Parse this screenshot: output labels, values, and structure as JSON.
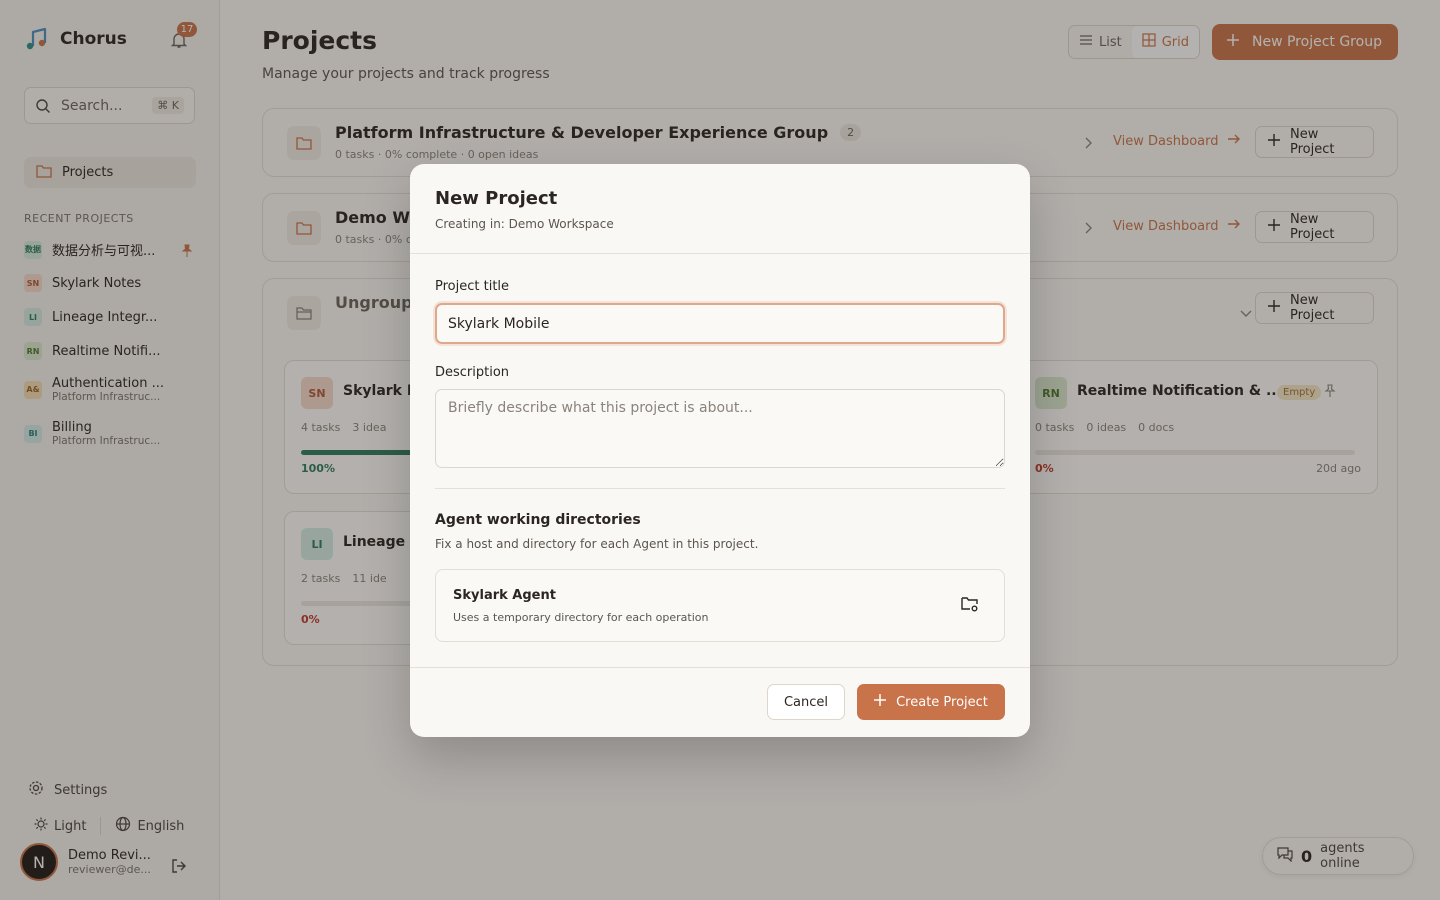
{
  "app": {
    "name": "Chorus",
    "notifications": "17"
  },
  "sidebar": {
    "search_placeholder": "Search...",
    "search_shortcut": "⌘ K",
    "nav_projects": "Projects",
    "recent_title": "RECENT PROJECTS",
    "recent": [
      {
        "abbr": "数据",
        "title": "数据分析与可视...",
        "sub": "",
        "pinned": true
      },
      {
        "abbr": "SN",
        "title": "Skylark Notes",
        "sub": ""
      },
      {
        "abbr": "LI",
        "title": "Lineage Integr...",
        "sub": ""
      },
      {
        "abbr": "RN",
        "title": "Realtime Notifi...",
        "sub": ""
      },
      {
        "abbr": "A&",
        "title": "Authentication ...",
        "sub": "Platform Infrastruc..."
      },
      {
        "abbr": "BI",
        "title": "Billing",
        "sub": "Platform Infrastruc..."
      }
    ],
    "settings": "Settings",
    "theme": "Light",
    "language": "English",
    "user": {
      "initial": "N",
      "name": "Demo Revi...",
      "email": "reviewer@de..."
    }
  },
  "main": {
    "title": "Projects",
    "subtitle": "Manage your projects and track progress",
    "view_list": "List",
    "view_grid": "Grid",
    "new_group": "New Project Group",
    "groups": [
      {
        "title": "Platform Infrastructure & Developer Experience Group",
        "count": "2",
        "meta": "0 tasks · 0% complete · 0 open ideas",
        "dashboard": "View Dashboard",
        "new_project": "New Project"
      },
      {
        "title": "Demo W",
        "meta": "0 tasks · 0% c",
        "dashboard": "View Dashboard",
        "new_project": "New Project"
      },
      {
        "title": "Ungroup",
        "new_project": "New Project"
      }
    ],
    "cards": [
      {
        "abbr": "SN",
        "title": "Skylark N",
        "tasks": "4 tasks",
        "ideas": "3 idea",
        "pct": "100%",
        "progress": 1.0
      },
      {
        "abbr": "RN",
        "title": "Realtime Notification & ...",
        "badge": "Empty",
        "tasks": "0 tasks",
        "ideas": "0 ideas",
        "docs": "0 docs",
        "pct": "0%",
        "age": "20d ago",
        "progress": 0
      },
      {
        "abbr": "LI",
        "title": "Lineage I",
        "tasks": "2 tasks",
        "ideas": "11 ide",
        "pct": "0%",
        "progress": 0
      }
    ],
    "agents_online": {
      "count": "0",
      "label": "agents online"
    }
  },
  "modal": {
    "title": "New Project",
    "subtitle": "Creating in: Demo Workspace",
    "title_label": "Project title",
    "title_value": "Skylark Mobile",
    "desc_label": "Description",
    "desc_placeholder": "Briefly describe what this project is about...",
    "agents_title": "Agent working directories",
    "agents_sub": "Fix a host and directory for each Agent in this project.",
    "agent": {
      "name": "Skylark Agent",
      "desc": "Uses a temporary directory for each operation"
    },
    "cancel": "Cancel",
    "create": "Create Project"
  },
  "colors": {
    "accent": "#c8734a",
    "success": "#2f7d5e",
    "danger": "#c0392b"
  }
}
